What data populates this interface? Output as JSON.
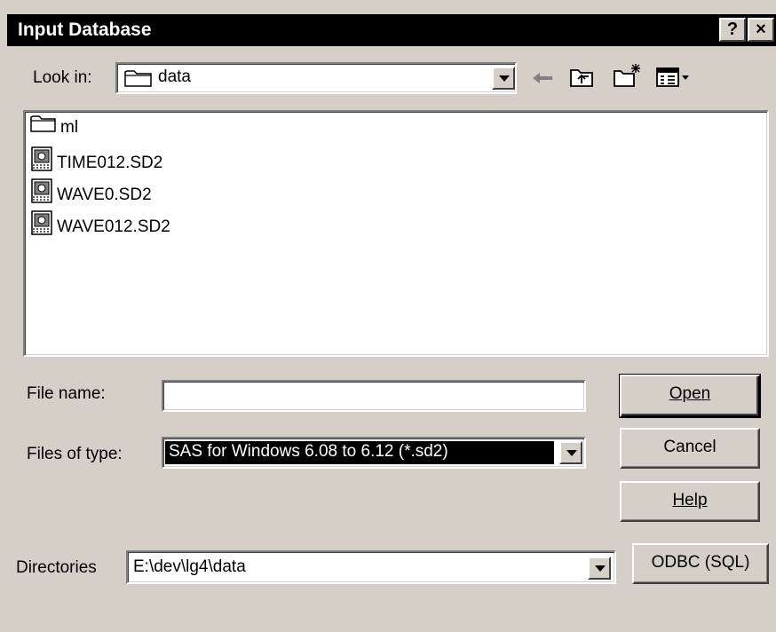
{
  "window": {
    "title": "Input Database"
  },
  "title_buttons": {
    "help": "?",
    "close": "×"
  },
  "look_in": {
    "label": "Look in:",
    "value": "data"
  },
  "files": [
    {
      "name": "ml",
      "kind": "folder"
    },
    {
      "name": "TIME012.SD2",
      "kind": "sas-file"
    },
    {
      "name": "WAVE0.SD2",
      "kind": "sas-file"
    },
    {
      "name": "WAVE012.SD2",
      "kind": "sas-file"
    }
  ],
  "file_name": {
    "label": "File name:",
    "value": ""
  },
  "files_of_type": {
    "label": "Files of type:",
    "value": "SAS for Windows 6.08 to 6.12 (*.sd2)"
  },
  "directories": {
    "label": "Directories",
    "value": "E:\\dev\\lg4\\data"
  },
  "buttons": {
    "open": "Open",
    "cancel": "Cancel",
    "help": "Help",
    "odbc": "ODBC (SQL)"
  },
  "toolbar_icons": [
    "back-arrow-icon",
    "up-folder-icon",
    "new-folder-icon",
    "view-menu-icon"
  ]
}
